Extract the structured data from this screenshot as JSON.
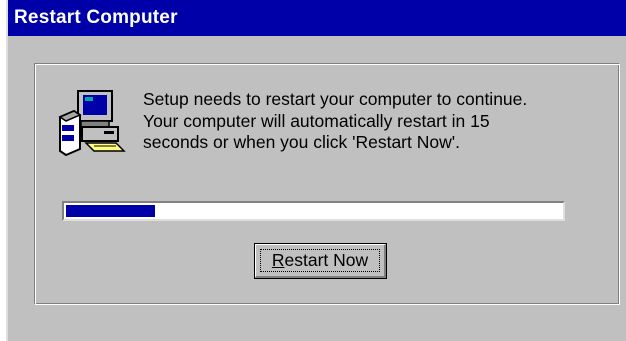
{
  "window": {
    "title": "Restart Computer"
  },
  "icon": {
    "name": "computer-setup-icon"
  },
  "message": {
    "line1": "Setup needs to restart your computer to continue.",
    "line2": "Your computer will automatically restart in 15",
    "line3": "seconds or when you click 'Restart Now'."
  },
  "progress": {
    "fraction": 0.18,
    "color": "#0000a8"
  },
  "button": {
    "accel": "R",
    "rest": "estart Now"
  },
  "colors": {
    "titlebar": "#0000a8",
    "face": "#c0c0c0"
  }
}
